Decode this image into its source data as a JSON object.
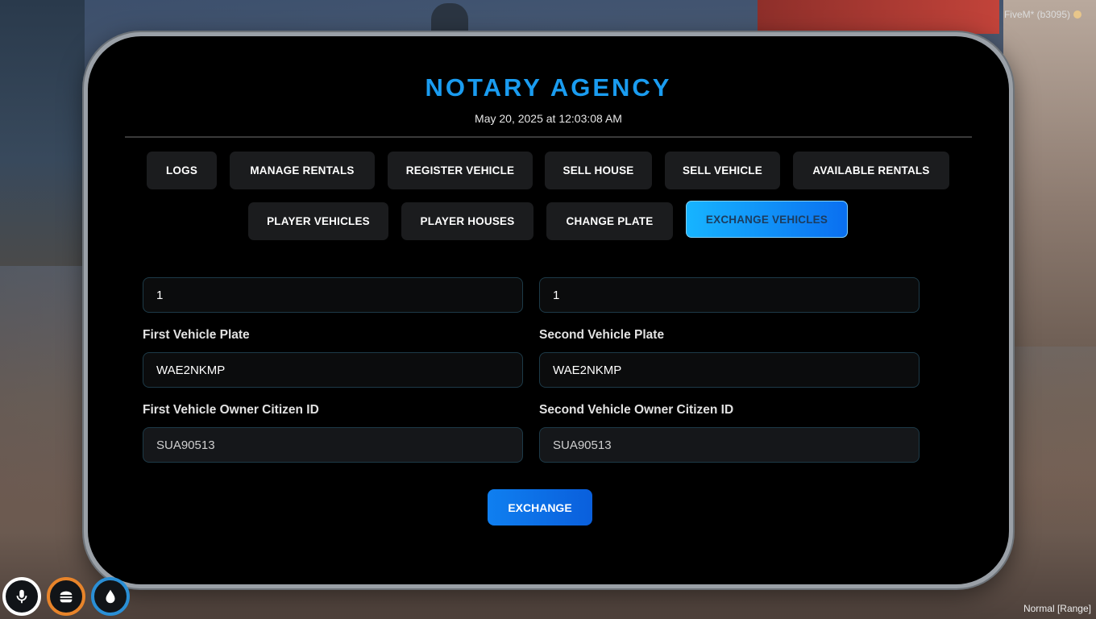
{
  "header": {
    "title": "NOTARY AGENCY",
    "datetime": "May 20, 2025 at 12:03:08 AM"
  },
  "nav": {
    "row1": [
      "LOGS",
      "MANAGE RENTALS",
      "REGISTER VEHICLE",
      "SELL HOUSE",
      "SELL VEHICLE",
      "AVAILABLE RENTALS"
    ],
    "row2": [
      "PLAYER VEHICLES",
      "PLAYER HOUSES",
      "CHANGE PLATE",
      "EXCHANGE VEHICLES"
    ],
    "active": "EXCHANGE VEHICLES"
  },
  "form": {
    "first_id_value": "1",
    "second_id_value": "1",
    "first_plate_label": "First Vehicle Plate",
    "first_plate_value": "WAE2NKMP",
    "second_plate_label": "Second Vehicle Plate",
    "second_plate_value": "WAE2NKMP",
    "first_owner_label": "First Vehicle Owner Citizen ID",
    "first_owner_value": "SUA90513",
    "second_owner_label": "Second Vehicle Owner Citizen ID",
    "second_owner_value": "SUA90513",
    "submit_label": "EXCHANGE"
  },
  "overlay": {
    "client": "FiveM* (b3095)",
    "voice_mode": "Normal [Range]"
  },
  "hud": {
    "icons": [
      "microphone-icon",
      "burger-icon",
      "water-drop-icon"
    ],
    "colors": {
      "voice": "#ffffff",
      "hunger": "#e8842a",
      "thirst": "#2a8fd6"
    }
  },
  "colors": {
    "accent": "#1a9cf0",
    "button_bg": "#1b1c1e",
    "active_start": "#17b4ff",
    "active_end": "#0a6ff0"
  }
}
